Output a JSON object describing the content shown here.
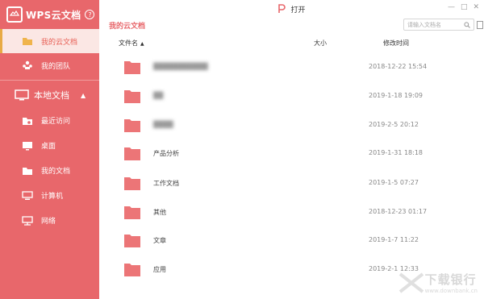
{
  "app": {
    "title": "WPS云文档",
    "help": "?"
  },
  "sidebar": {
    "top_items": [
      {
        "label": "我的云文档",
        "icon": "folder-icon",
        "active": true
      },
      {
        "label": "我的团队",
        "icon": "team-icon",
        "active": false
      }
    ],
    "local_group": {
      "label": "本地文档",
      "icon": "monitor-icon",
      "caret": "▲"
    },
    "local_items": [
      {
        "label": "最近访问",
        "icon": "recent-icon"
      },
      {
        "label": "桌面",
        "icon": "desktop-icon"
      },
      {
        "label": "我的文档",
        "icon": "documents-icon"
      },
      {
        "label": "计算机",
        "icon": "computer-icon"
      },
      {
        "label": "网络",
        "icon": "network-icon"
      }
    ]
  },
  "toolbar": {
    "open_label": "打开"
  },
  "breadcrumb": "我的云文档",
  "search": {
    "placeholder": "请输入文档名"
  },
  "table": {
    "columns": {
      "name": "文件名",
      "size": "大小",
      "modified": "修改时间"
    },
    "rows": [
      {
        "name": "███████████",
        "date": "2018-12-22 15:54",
        "obscured": true
      },
      {
        "name": "██",
        "date": "2019-1-18 19:09",
        "obscured": true
      },
      {
        "name": "████",
        "date": "2019-2-5 20:12",
        "obscured": true
      },
      {
        "name": "产品分析",
        "date": "2019-1-31 18:18",
        "obscured": false
      },
      {
        "name": "工作文档",
        "date": "2019-1-5 07:27",
        "obscured": false
      },
      {
        "name": "其他",
        "date": "2018-12-23 01:17",
        "obscured": false
      },
      {
        "name": "文章",
        "date": "2019-1-7 11:22",
        "obscured": false
      },
      {
        "name": "应用",
        "date": "2019-2-1 12:33",
        "obscured": false
      }
    ]
  },
  "colors": {
    "sidebar": "#e8676b",
    "folder": "#ec7577",
    "accent": "#e8aa44"
  },
  "watermark": {
    "brand": "下载银行",
    "url": "www.downbank.cn"
  }
}
